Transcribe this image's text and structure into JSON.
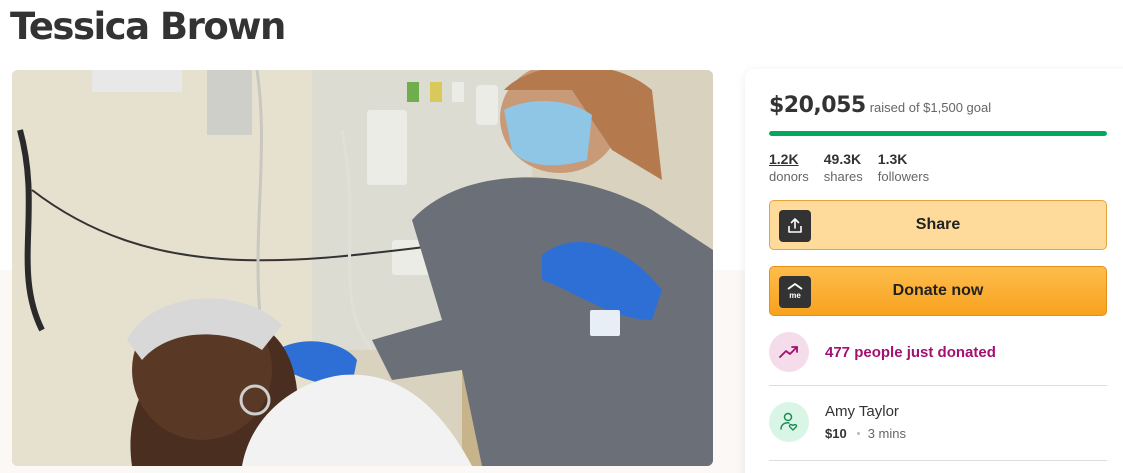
{
  "campaign": {
    "title": "Tessica Brown"
  },
  "fundraiser": {
    "amount_raised": "$20,055",
    "goal_text": "raised of $1,500 goal",
    "progress_fraction": 1.0
  },
  "stats": [
    {
      "value": "1.2K",
      "label": "donors"
    },
    {
      "value": "49.3K",
      "label": "shares"
    },
    {
      "value": "1.3K",
      "label": "followers"
    }
  ],
  "buttons": {
    "share_label": "Share",
    "donate_label": "Donate now",
    "donate_icon_text": "me"
  },
  "activity": {
    "just_donated": "477 people just donated"
  },
  "recent_donation": {
    "name": "Amy Taylor",
    "amount": "$10",
    "time": "3 mins"
  },
  "colors": {
    "progress": "#02a95c",
    "share_button": "#fedb9b",
    "donate_button": "#f8a21e",
    "trend_text": "#a3106f"
  },
  "icons": {
    "share": "share-upload-icon",
    "donate": "gofundme-logo-icon",
    "trend": "trending-up-icon",
    "donor": "donor-heart-icon"
  }
}
